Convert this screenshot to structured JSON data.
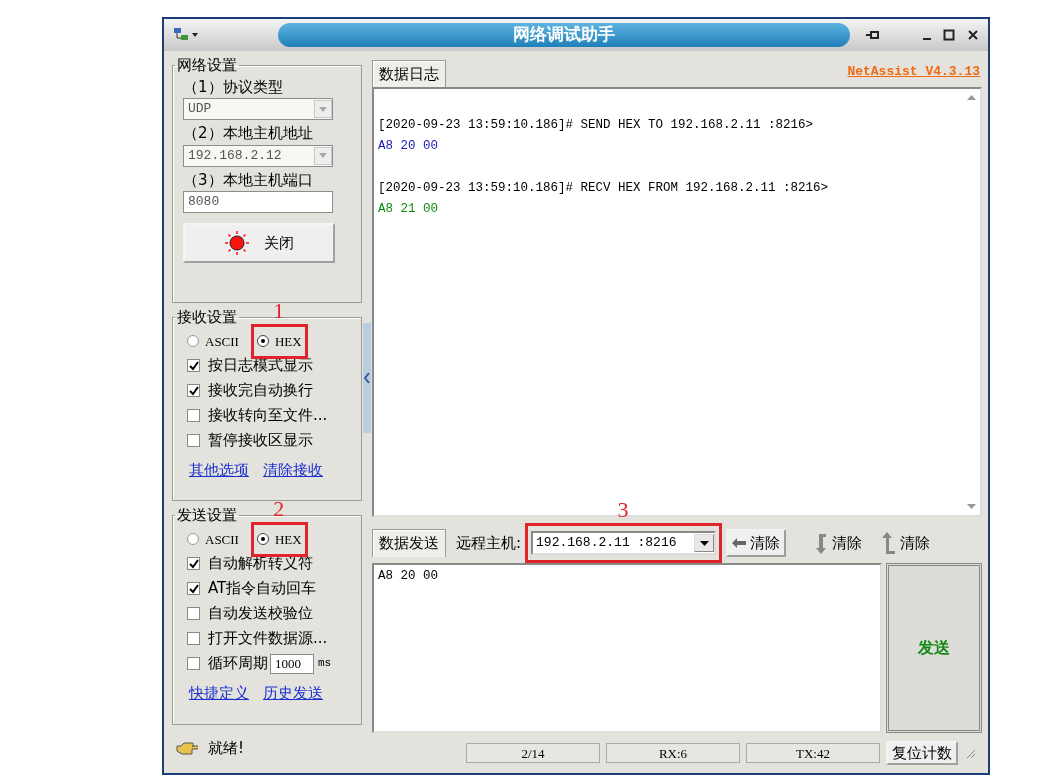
{
  "window": {
    "title": "网络调试助手"
  },
  "network_settings": {
    "title": "网络设置",
    "fields": [
      {
        "label": "（1）协议类型",
        "value": "UDP",
        "kind": "dropdown",
        "disabled": true
      },
      {
        "label": "（2）本地主机地址",
        "value": "192.168.2.12",
        "kind": "dropdown",
        "disabled": true
      },
      {
        "label": "（3）本地主机端口",
        "value": "8080",
        "kind": "text"
      }
    ],
    "connect_button": {
      "label": "关闭",
      "on": true
    }
  },
  "receive_settings": {
    "title": "接收设置",
    "modes": [
      {
        "label": "ASCII",
        "selected": false
      },
      {
        "label": "HEX",
        "selected": true,
        "callout": "1"
      }
    ],
    "options": [
      {
        "label": "按日志模式显示",
        "checked": true
      },
      {
        "label": "接收完自动换行",
        "checked": true
      },
      {
        "label": "接收转向至文件...",
        "checked": false
      },
      {
        "label": "暂停接收区显示",
        "checked": false
      }
    ],
    "links": [
      "其他选项",
      "清除接收"
    ]
  },
  "send_settings": {
    "title": "发送设置",
    "modes": [
      {
        "label": "ASCII",
        "selected": false
      },
      {
        "label": "HEX",
        "selected": true,
        "callout": "2"
      }
    ],
    "options": [
      {
        "label": "自动解析转义符",
        "checked": true
      },
      {
        "label": "AT指令自动回车",
        "checked": true
      },
      {
        "label": "自动发送校验位",
        "checked": false
      },
      {
        "label": "打开文件数据源...",
        "checked": false
      },
      {
        "label": "循环周期",
        "checked": false,
        "kind": "period",
        "value": "1000",
        "unit": "ms"
      }
    ],
    "links": [
      "快捷定义",
      "历史发送"
    ]
  },
  "status": "就绪!",
  "log": {
    "tab": "数据日志",
    "version": "NetAssist V4.3.13",
    "entries": [
      {
        "header": "[2020-09-23 13:59:10.186]# SEND HEX TO 192.168.2.11 :8216>",
        "data": "A8 20 00",
        "kind": "send"
      },
      {
        "header": "[2020-09-23 13:59:10.186]# RECV HEX FROM 192.168.2.11 :8216>",
        "data": "A8 21 00",
        "kind": "recv"
      }
    ]
  },
  "send": {
    "tab": "数据发送",
    "remote_label": "远程主机:",
    "remote_host": "192.168.2.11 :8216",
    "remote_host_callout": "3",
    "clear_buttons": [
      {
        "label": "清除",
        "kind": "raised"
      },
      {
        "label": "清除",
        "kind": "flat"
      },
      {
        "label": "清除",
        "kind": "flat"
      }
    ],
    "text": "A8 20 00",
    "send_button": "发送"
  },
  "status_bar": {
    "cells": [
      "2/14",
      "RX:6",
      "TX:42"
    ],
    "reset_button": "复位计数"
  }
}
